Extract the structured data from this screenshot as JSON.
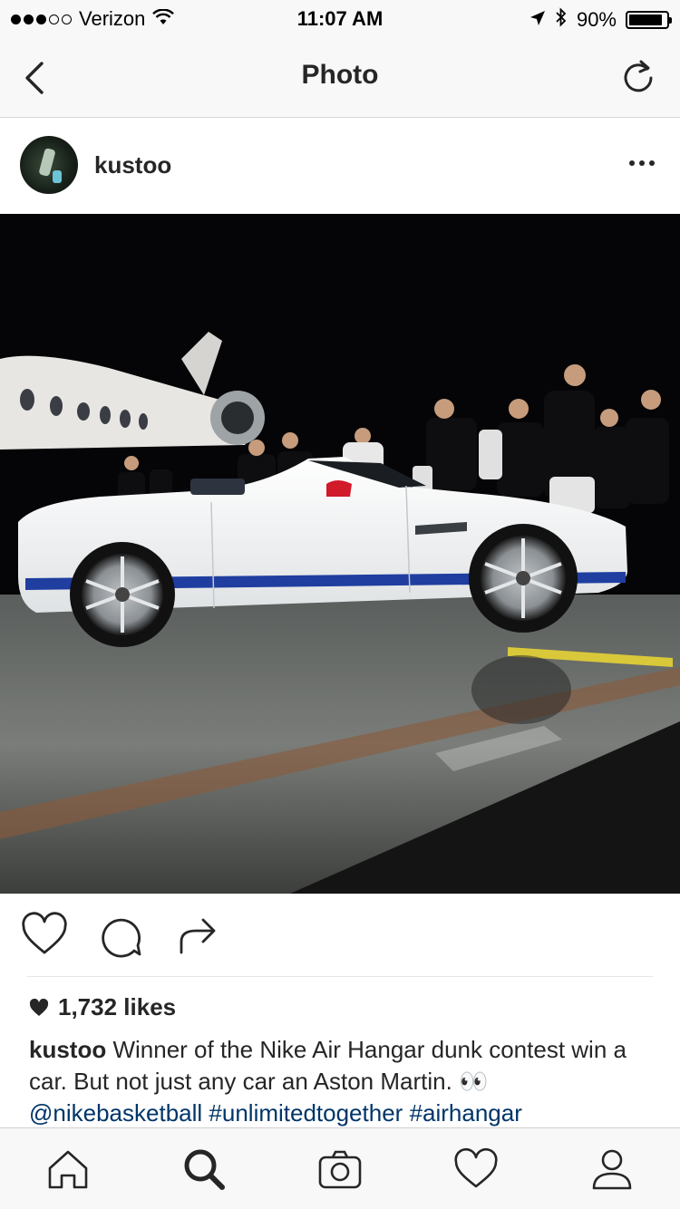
{
  "status_bar": {
    "carrier": "Verizon",
    "signal_bars_filled": 3,
    "signal_bars_total": 5,
    "time": "11:07 AM",
    "battery_percent": "90%",
    "battery_level": 0.9,
    "icons": [
      "wifi-icon",
      "location-arrow-icon",
      "bluetooth-icon",
      "battery-icon"
    ]
  },
  "nav": {
    "title": "Photo",
    "back_icon": "chevron-left-icon",
    "refresh_icon": "refresh-icon"
  },
  "post": {
    "username": "kustoo",
    "more_icon": "more-horizontal-icon",
    "photo_description_icon": "post-photo",
    "likes": "1,732 likes",
    "caption_user": "kustoo",
    "caption_text": "Winner of the Nike Air Hangar dunk contest win a car. But not just any car an Aston Martin. 👀",
    "caption_links": [
      "@nikebasketball",
      "#unlimitedtogether",
      "#airhangar"
    ]
  },
  "actions": {
    "like_icon": "heart-outline-icon",
    "comment_icon": "comment-icon",
    "share_icon": "share-arrow-icon"
  },
  "tab_bar": {
    "items": [
      "home-icon",
      "search-icon",
      "camera-icon",
      "activity-heart-icon",
      "profile-icon"
    ],
    "active": "search-icon"
  }
}
